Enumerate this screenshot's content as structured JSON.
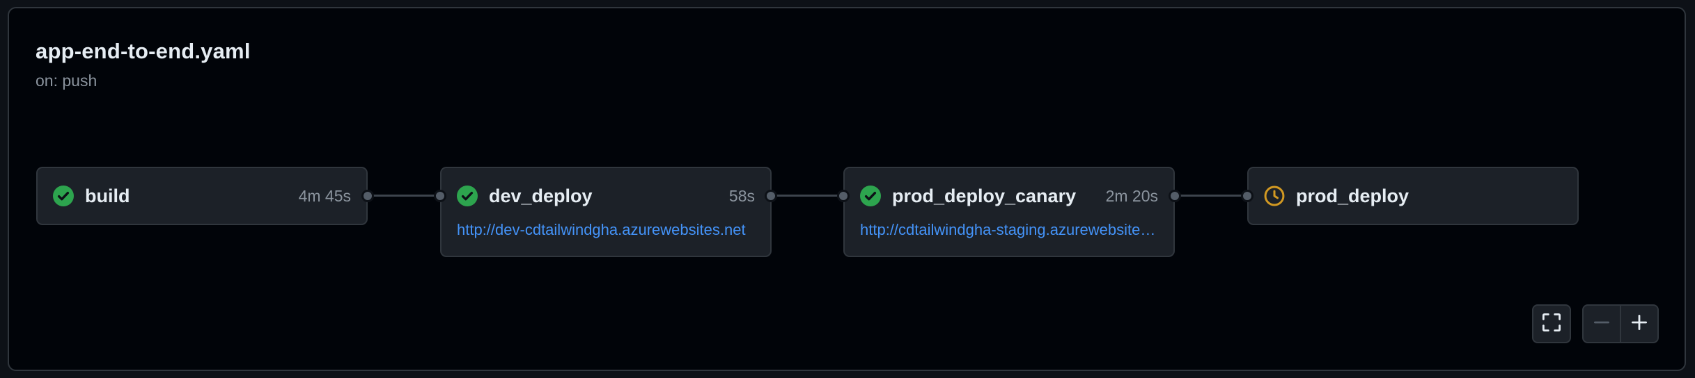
{
  "workflow": {
    "title": "app-end-to-end.yaml",
    "trigger": "on: push"
  },
  "jobs": [
    {
      "name": "build",
      "status": "success",
      "duration": "4m 45s",
      "url": ""
    },
    {
      "name": "dev_deploy",
      "status": "success",
      "duration": "58s",
      "url": "http://dev-cdtailwindgha.azurewebsites.net"
    },
    {
      "name": "prod_deploy_canary",
      "status": "success",
      "duration": "2m 20s",
      "url": "http://cdtailwindgha-staging.azurewebsite…"
    },
    {
      "name": "prod_deploy",
      "status": "waiting",
      "duration": "",
      "url": ""
    }
  ],
  "colors": {
    "success": "#2da44e",
    "waiting": "#d29922",
    "link": "#4493f8"
  },
  "icons": {
    "success": "check-circle-fill-icon",
    "waiting": "clock-icon",
    "fullscreen": "screen-full-icon",
    "zoom_out": "dash-icon",
    "zoom_in": "plus-icon"
  }
}
